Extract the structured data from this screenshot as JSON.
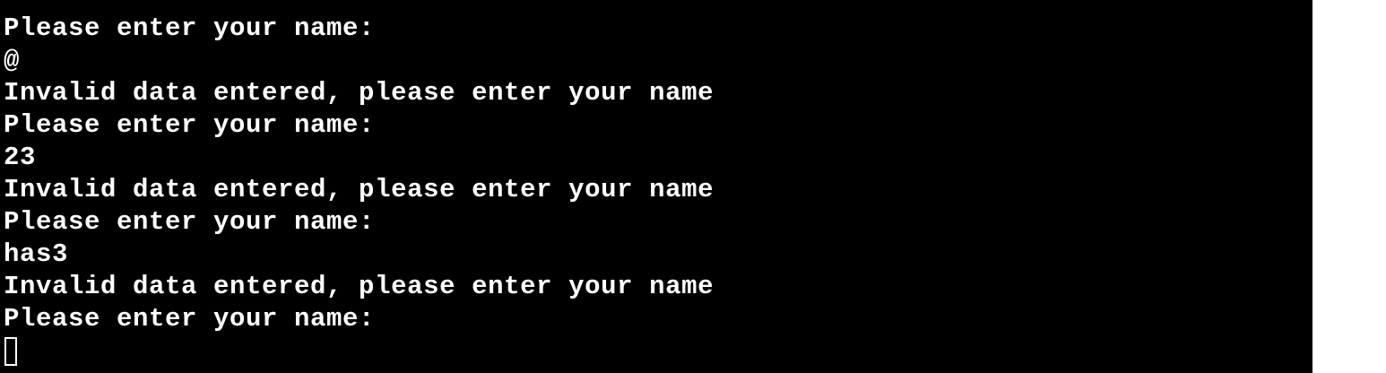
{
  "terminal": {
    "lines": [
      "-----------------------------------",
      "Please enter your name:",
      "@",
      "Invalid data entered, please enter your name",
      "Please enter your name:",
      "23",
      "Invalid data entered, please enter your name",
      "Please enter your name:",
      "has3",
      "Invalid data entered, please enter your name",
      "Please enter your name:"
    ],
    "colors": {
      "background": "#000000",
      "foreground": "#ffffff",
      "page": "#ffffff"
    }
  }
}
